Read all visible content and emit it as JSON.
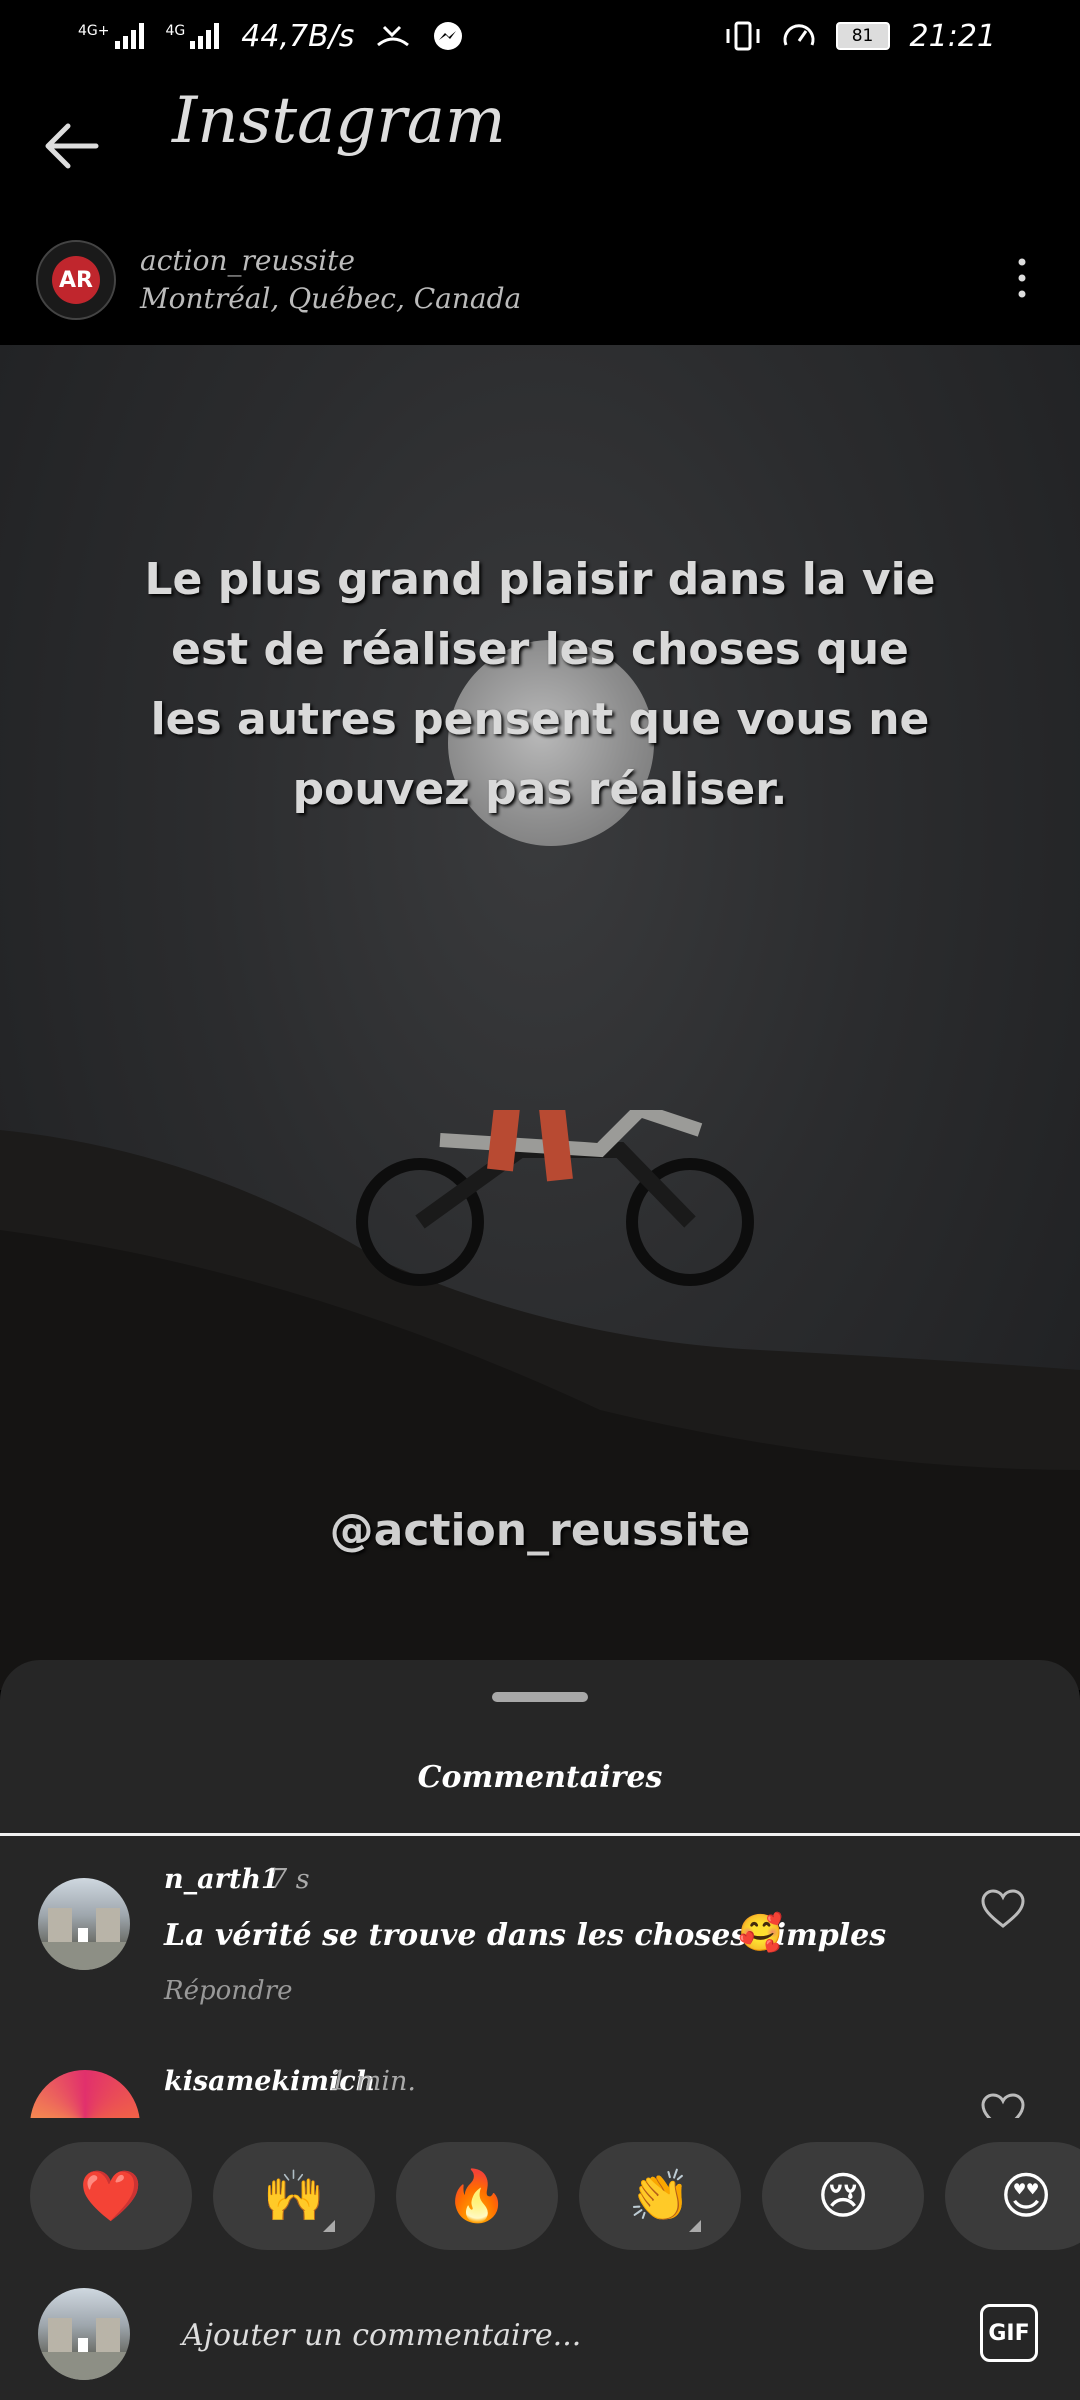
{
  "status_bar": {
    "net1": "4G+",
    "net2": "4G",
    "speed": "44,7B/s",
    "battery": "81",
    "time": "21:21"
  },
  "header": {
    "title": "Instagram",
    "avatar_text": "AR",
    "username": "action_reussite",
    "location": "Montréal, Québec, Canada"
  },
  "post": {
    "quote": "Le plus grand plaisir dans la vie est de réaliser les choses que les autres pensent que vous ne pouvez pas réaliser.",
    "handle": "@action_reussite"
  },
  "comments": {
    "title": "Commentaires",
    "items": [
      {
        "user": "n_arth1",
        "time": "7 s",
        "text": "La vérité se trouve dans les choses simples",
        "emoji": "🥰",
        "reply": "Répondre"
      },
      {
        "user": "kisamekimich",
        "time": "1 min."
      }
    ]
  },
  "reactions": [
    "❤️",
    "🙌",
    "🔥",
    "👏",
    "😢",
    "😍"
  ],
  "composer": {
    "placeholder": "Ajouter un commentaire...",
    "gif": "GIF"
  },
  "colors": {
    "sheet": "#262626",
    "pill": "#3b3b3b",
    "heart": "#e0245e"
  }
}
